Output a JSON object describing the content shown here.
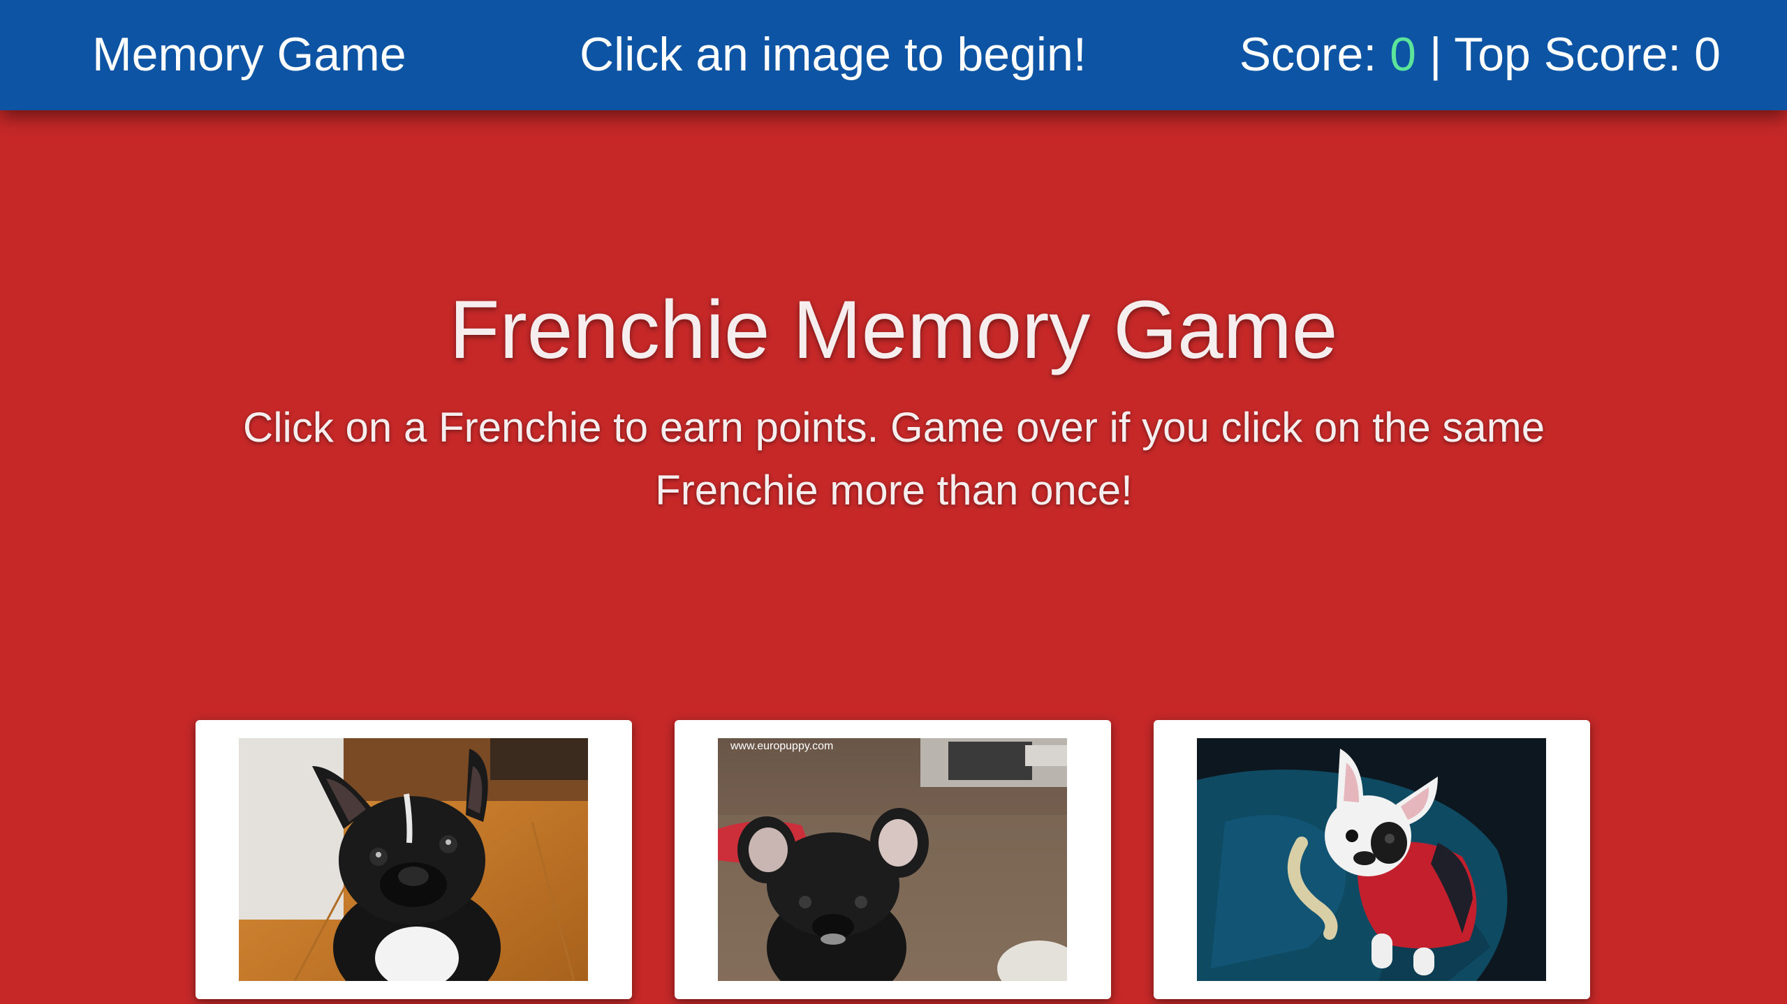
{
  "navbar": {
    "brand": "Memory Game",
    "message": "Click an image to begin!",
    "score_label": "Score: ",
    "score_value": "0",
    "separator": " | ",
    "top_score_label": "Top Score: ",
    "top_score_value": "0"
  },
  "hero": {
    "title": "Frenchie Memory Game",
    "subtitle": "Click on a Frenchie to earn points. Game over if you click on the same Frenchie more than once!"
  },
  "cards": [
    {
      "watermark": ""
    },
    {
      "watermark": "www.europuppy.com"
    },
    {
      "watermark": ""
    }
  ],
  "colors": {
    "navbar_bg": "#0d54a4",
    "page_bg": "#c62828",
    "score_accent": "#5ce59a"
  }
}
